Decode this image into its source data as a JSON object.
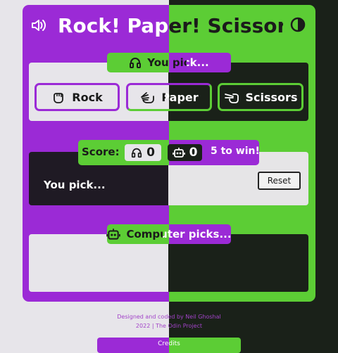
{
  "header": {
    "title": "Rock! Paper! Scissors!",
    "sound_icon": "volume-icon",
    "theme_icon": "contrast-icon"
  },
  "player": {
    "label": "You pick...",
    "icon": "headphones-icon",
    "choices": [
      {
        "label": "Rock",
        "icon": "fist-icon"
      },
      {
        "label": "Paper",
        "icon": "open-hand-icon"
      },
      {
        "label": "Scissors",
        "icon": "scissors-hand-icon"
      }
    ]
  },
  "score": {
    "label": "Score:",
    "player_score": "0",
    "computer_score": "0",
    "goal": "5 to win!",
    "status": "You pick...",
    "reset_label": "Reset"
  },
  "computer": {
    "label": "Computer picks...",
    "icon": "robot-icon"
  },
  "footer": {
    "credit_line": "Designed and coded by Neil Ghoshal",
    "year_line": "2022 |  The Odin Project",
    "button_label": "Credits"
  },
  "colors": {
    "purple": "#9b2ad6",
    "green": "#5ccd35",
    "light_bg": "#e7e5ea",
    "dark_bg": "#1a2119"
  }
}
